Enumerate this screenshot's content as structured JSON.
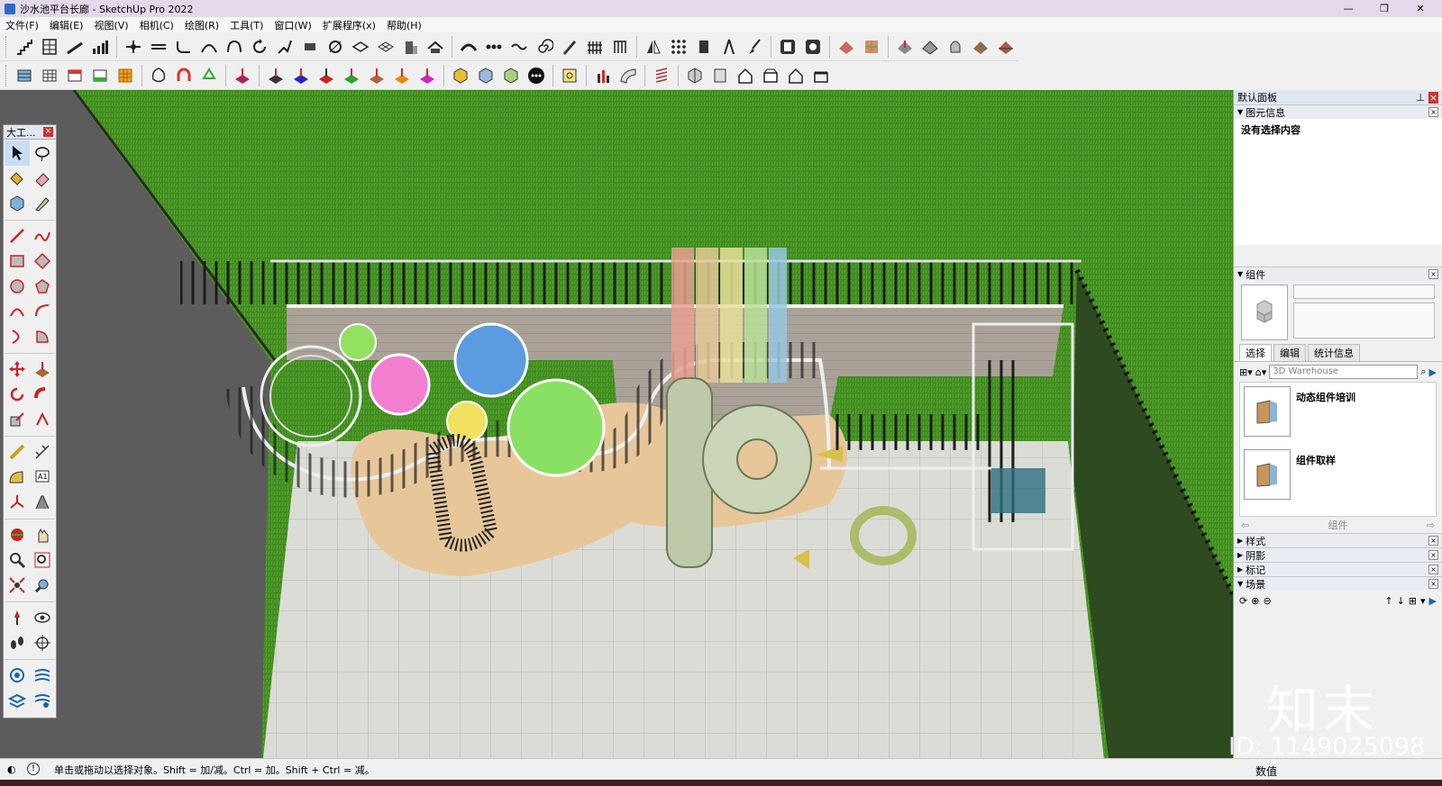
{
  "window": {
    "title": "沙水池平台长廊 - SketchUp Pro 2022",
    "minimize": "—",
    "maximize": "❐",
    "close": "✕"
  },
  "menu": [
    "文件(F)",
    "编辑(E)",
    "视图(V)",
    "相机(C)",
    "绘图(R)",
    "工具(T)",
    "窗口(W)",
    "扩展程序(x)",
    "帮助(H)"
  ],
  "tool_palette": {
    "title": "大工...",
    "close": "×"
  },
  "tray": {
    "title": "默认面板",
    "entity_info": {
      "label": "图元信息",
      "body": "没有选择内容"
    },
    "components": {
      "label": "组件",
      "tabs": [
        "选择",
        "编辑",
        "统计信息"
      ],
      "search_placeholder": "3D Warehouse",
      "items": [
        "动态组件培训",
        "组件取样"
      ],
      "footer": "组件"
    },
    "styles": "样式",
    "shadows": "阴影",
    "tags": "标记",
    "scenes": "场景"
  },
  "status": {
    "hint": "单击或拖动以选择对象。Shift = 加/减。Ctrl = 加。Shift + Ctrl = 减。",
    "vcb_label": "数值"
  },
  "watermark": {
    "logo": "知末",
    "id": "ID: 1149025098"
  },
  "colors": {
    "grass": "#3e8a1e",
    "road": "#5a5a5a",
    "deck": "#a9a198",
    "paving": "#d9d9d4",
    "sand": "#e7c79a"
  }
}
